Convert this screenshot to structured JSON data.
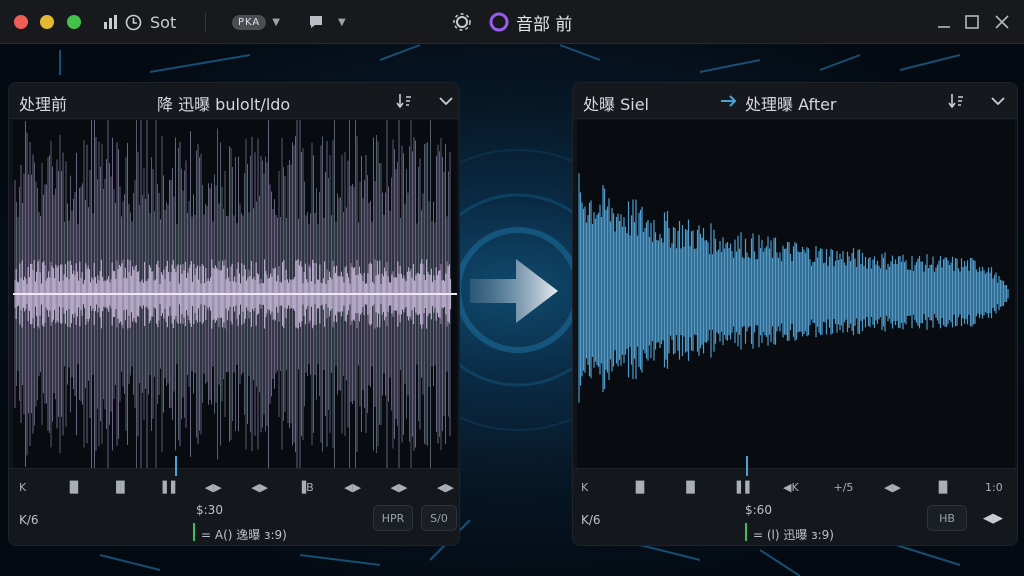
{
  "titlebar": {
    "app_name": "Sot",
    "pill": "PKA",
    "title": "音部 前"
  },
  "left_panel": {
    "title": "处理前",
    "subtitle": "降 迅曝 bulolt/ldo",
    "transport": [
      "K",
      "▐▌",
      "▐▌",
      "▐▐",
      "◀▶",
      "◀▶",
      "▐B",
      "◀▶",
      "◀▶",
      "◀▶"
    ],
    "corner_label": "K/6",
    "time": "$:30",
    "channel": "= A() 逸曝 ɜ:9)",
    "btn_left": "HPR",
    "btn_right": "S/0"
  },
  "right_panel": {
    "title_left": "处曝 Siel",
    "title_right": "处理曝 After",
    "transport": [
      "K",
      "▐▌",
      "▐▌",
      "▐▐",
      "◀K",
      "+/5",
      "◀▶",
      "▐▌",
      "1:0"
    ],
    "corner_label": "K/6",
    "time": "$:60",
    "channel": "= (l) 迅曝 ɜ:9)",
    "btn_left": "HB",
    "btn_right": "◀▶"
  },
  "colors": {
    "accent": "#4aa3d8",
    "before_wave": "#b7a3cf",
    "after_wave": "#5aa6d6",
    "record_green": "#3fbf5a"
  }
}
